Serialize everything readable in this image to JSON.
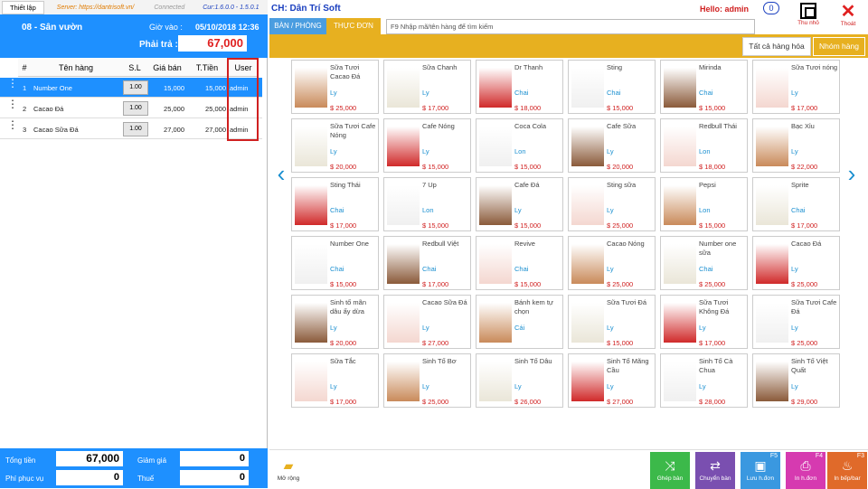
{
  "top": {
    "settings_tab": "Thiết lập",
    "server": "Server: https://dantrisoft.vn/",
    "connection": "Connected",
    "version": "Cur:1.6.0.0 - 1.5.0.1"
  },
  "order_panel": {
    "table_name": "08 - Sân vườn",
    "checkin_label": "Giờ vào :",
    "checkin_time": "05/10/2018 12:36",
    "pay_label": "Phải trả :",
    "pay_value": "67,000"
  },
  "order_table": {
    "columns": [
      "#",
      "Tên hàng",
      "S.L",
      "Giá bán",
      "T.Tiền",
      "User"
    ],
    "rows": [
      {
        "no": "1",
        "name": "Number One",
        "qty": "1.00",
        "price": "15,000",
        "total": "15,000",
        "user": "admin"
      },
      {
        "no": "2",
        "name": "Cacao Đá",
        "qty": "1.00",
        "price": "25,000",
        "total": "25,000",
        "user": "admin"
      },
      {
        "no": "3",
        "name": "Cacao Sữa Đá",
        "qty": "1.00",
        "price": "27,000",
        "total": "27,000",
        "user": "admin"
      }
    ]
  },
  "totals": {
    "total_label": "Tổng tiền",
    "total_value": "67,000",
    "discount_label": "Giảm giá",
    "discount_value": "0",
    "service_label": "Phí phục vụ",
    "service_value": "0",
    "tax_label": "Thuế",
    "tax_value": "0"
  },
  "header": {
    "store": "CH: Dân Trí Soft",
    "hello": "Hello: admin",
    "badge": "0",
    "minimize": "Thu nhỏ",
    "exit": "Thoát"
  },
  "tabs": {
    "tables": "BÀN / PHÒNG",
    "menu": "THỰC ĐƠN"
  },
  "search": {
    "placeholder": "F9 Nhập mã/tên hàng để tìm kiếm"
  },
  "categories": {
    "all": "Tất cả hàng hóa",
    "groups": "Nhóm hàng"
  },
  "products": [
    [
      {
        "name": "Sữa Tươi Cacao Đá",
        "unit": "Ly",
        "price": "$ 25,000"
      },
      {
        "name": "Sữa Chanh",
        "unit": "Ly",
        "price": "$ 17,000"
      },
      {
        "name": "Dr Thanh",
        "unit": "Chai",
        "price": "$ 18,000"
      },
      {
        "name": "Sting",
        "unit": "Chai",
        "price": "$ 15,000"
      },
      {
        "name": "Mirinda",
        "unit": "Chai",
        "price": "$ 15,000"
      },
      {
        "name": "Sữa Tươi nóng",
        "unit": "Ly",
        "price": "$ 17,000"
      }
    ],
    [
      {
        "name": "Sữa Tươi Cafe Nóng",
        "unit": "Ly",
        "price": "$ 20,000"
      },
      {
        "name": "Cafe Nóng",
        "unit": "Ly",
        "price": "$ 15,000"
      },
      {
        "name": "Coca Cola",
        "unit": "Lon",
        "price": "$ 15,000"
      },
      {
        "name": "Cafe Sữa",
        "unit": "Ly",
        "price": "$ 20,000"
      },
      {
        "name": "Redbull Thái",
        "unit": "Lon",
        "price": "$ 18,000"
      },
      {
        "name": "Bạc Xỉu",
        "unit": "Ly",
        "price": "$ 22,000"
      }
    ],
    [
      {
        "name": "Sting Thái",
        "unit": "Chai",
        "price": "$ 17,000"
      },
      {
        "name": "7 Up",
        "unit": "Lon",
        "price": "$ 15,000"
      },
      {
        "name": "Cafe Đá",
        "unit": "Ly",
        "price": "$ 15,000"
      },
      {
        "name": "Sting sữa",
        "unit": "Ly",
        "price": "$ 25,000"
      },
      {
        "name": "Pepsi",
        "unit": "Lon",
        "price": "$ 15,000"
      },
      {
        "name": "Sprite",
        "unit": "Chai",
        "price": "$ 17,000"
      }
    ],
    [
      {
        "name": "Number One",
        "unit": "Chai",
        "price": "$ 15,000"
      },
      {
        "name": "Redbull Việt",
        "unit": "Chai",
        "price": "$ 17,000"
      },
      {
        "name": "Revive",
        "unit": "Chai",
        "price": "$ 15,000"
      },
      {
        "name": "Cacao Nóng",
        "unit": "Ly",
        "price": "$ 25,000"
      },
      {
        "name": "Number one sữa",
        "unit": "Chai",
        "price": "$ 25,000"
      },
      {
        "name": "Cacao Đá",
        "unit": "Ly",
        "price": "$ 25,000"
      }
    ],
    [
      {
        "name": "Sinh tố mãn dâu ấy dừa",
        "unit": "Ly",
        "price": "$ 20,000"
      },
      {
        "name": "Cacao Sữa Đá",
        "unit": "Ly",
        "price": "$ 27,000"
      },
      {
        "name": "Bánh kem tự chọn",
        "unit": "Cái",
        "price": ""
      },
      {
        "name": "Sữa Tươi Đá",
        "unit": "Ly",
        "price": "$ 15,000"
      },
      {
        "name": "Sữa Tươi Không Đá",
        "unit": "Ly",
        "price": "$ 17,000"
      },
      {
        "name": "Sữa Tươi Cafe Đá",
        "unit": "Ly",
        "price": "$ 25,000"
      }
    ],
    [
      {
        "name": "Sữa Tắc",
        "unit": "Ly",
        "price": "$ 17,000"
      },
      {
        "name": "Sinh Tố Bơ",
        "unit": "Ly",
        "price": "$ 25,000"
      },
      {
        "name": "Sinh Tố Dâu",
        "unit": "Ly",
        "price": "$ 26,000"
      },
      {
        "name": "Sinh Tố Mãng Cầu",
        "unit": "Ly",
        "price": "$ 27,000"
      },
      {
        "name": "Sinh Tố Cà Chua",
        "unit": "Ly",
        "price": "$ 28,000"
      },
      {
        "name": "Sinh Tố Việt Quất",
        "unit": "Ly",
        "price": "$ 29,000"
      }
    ]
  ],
  "footer": {
    "more": "Mở rộng",
    "merge": "Ghép bàn",
    "move": "Chuyển bàn",
    "save_key": "F5",
    "save": "Lưu h.đơn",
    "print_key": "F4",
    "print": "In h.đơn",
    "kitchen_key": "F3",
    "kitchen": "In bếp/bar"
  },
  "colors": {
    "accent": "#1e90ff",
    "gold": "#e7b020",
    "red": "#d02020"
  }
}
